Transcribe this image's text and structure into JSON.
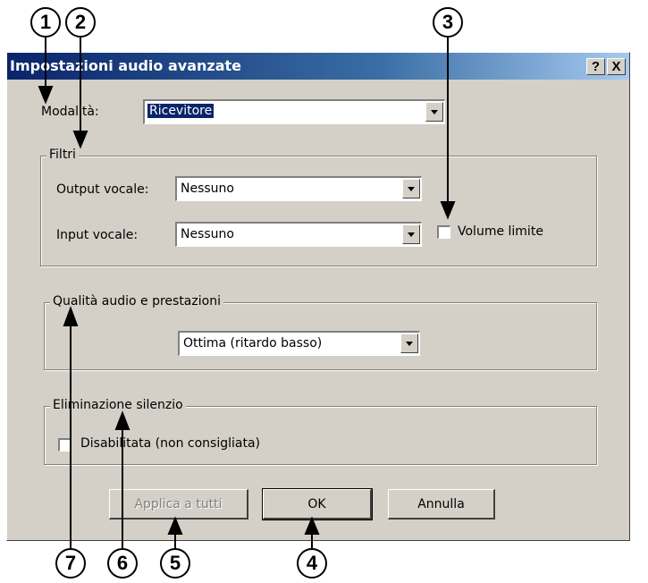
{
  "dialog": {
    "title": "Impostazioni audio avanzate",
    "help_button": "?",
    "close_button": "X"
  },
  "mode": {
    "label": "Modalità:",
    "value": "Ricevitore"
  },
  "filters": {
    "legend": "Filtri",
    "output_label": "Output vocale:",
    "output_value": "Nessuno",
    "input_label": "Input vocale:",
    "input_value": "Nessuno",
    "limit_volume_label": "Volume limite",
    "limit_volume_checked": false
  },
  "quality": {
    "legend": "Qualità audio e prestazioni",
    "value": "Ottima (ritardo basso)"
  },
  "silence": {
    "legend": "Eliminazione silenzio",
    "disabled_label": "Disabilitata (non consigliata)",
    "disabled_checked": false
  },
  "buttons": {
    "apply_all": "Applica a tutti",
    "ok": "OK",
    "cancel": "Annulla"
  },
  "callouts": [
    "1",
    "2",
    "3",
    "4",
    "5",
    "6",
    "7"
  ],
  "figure_id": "105249"
}
